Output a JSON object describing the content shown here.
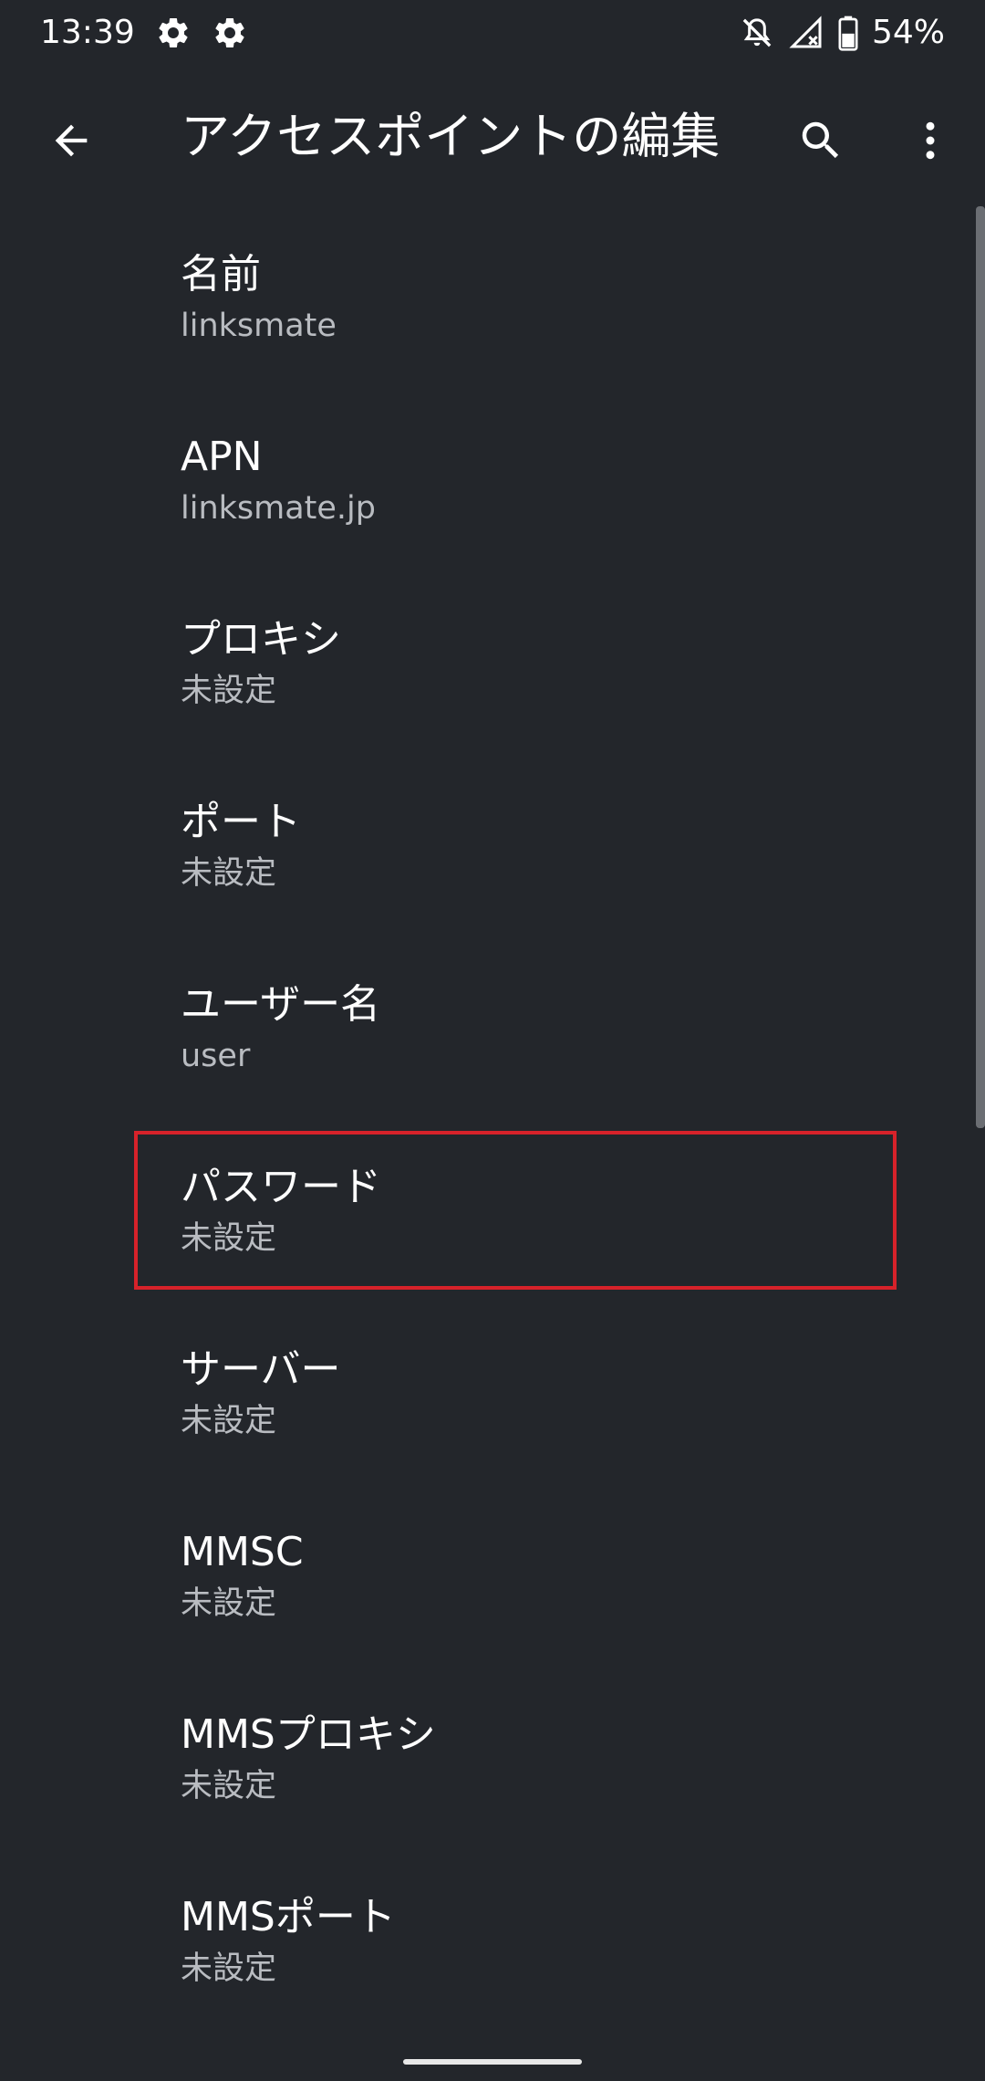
{
  "status_bar": {
    "time": "13:39",
    "battery_text": "54%",
    "icons": [
      "settings-gear-icon",
      "settings-gear-icon",
      "notifications-off-icon",
      "no-signal-icon",
      "battery-icon"
    ]
  },
  "app_bar": {
    "title": "アクセスポイントの編集",
    "back_icon": "arrow-back-icon",
    "search_icon": "search-icon",
    "more_icon": "more-vert-icon"
  },
  "preferences": [
    {
      "title": "名前",
      "summary": "linksmate"
    },
    {
      "title": "APN",
      "summary": "linksmate.jp"
    },
    {
      "title": "プロキシ",
      "summary": "未設定"
    },
    {
      "title": "ポート",
      "summary": "未設定"
    },
    {
      "title": "ユーザー名",
      "summary": "user"
    },
    {
      "title": "パスワード",
      "summary": "未設定"
    },
    {
      "title": "サーバー",
      "summary": "未設定"
    },
    {
      "title": "MMSC",
      "summary": "未設定"
    },
    {
      "title": "MMSプロキシ",
      "summary": "未設定"
    },
    {
      "title": "MMSポート",
      "summary": "未設定"
    }
  ],
  "highlight": {
    "target": "パスワード",
    "color": "#d7222a"
  },
  "colors": {
    "background": "#23262b",
    "primary_text": "#ffffff",
    "secondary_text": "#b9bcc1"
  }
}
